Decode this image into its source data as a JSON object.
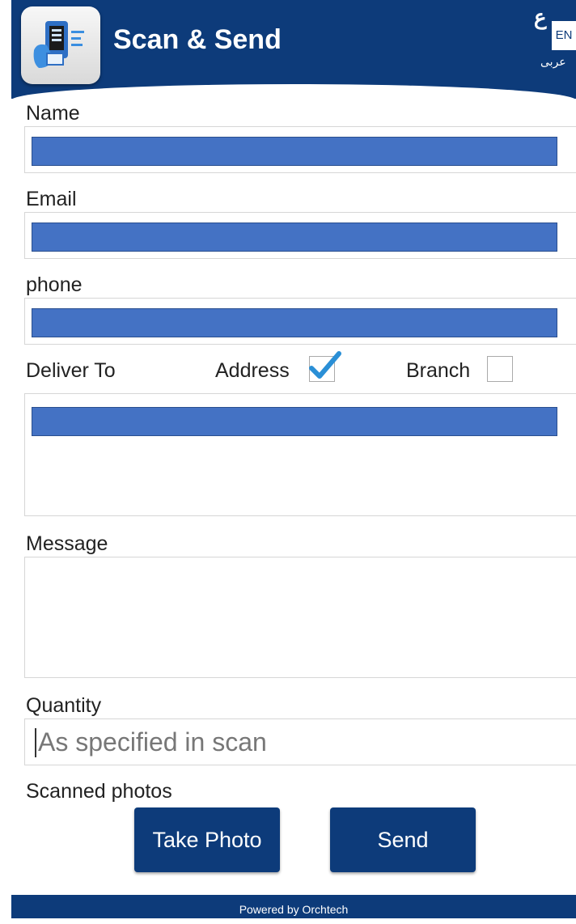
{
  "header": {
    "title": "Scan & Send",
    "app_icon": "scan-phone-icon",
    "lang_glyph": "ع",
    "lang_en": "EN",
    "lang_label": "عربى"
  },
  "form": {
    "name_label": "Name",
    "email_label": "Email",
    "phone_label": "phone",
    "deliver_label": "Deliver To",
    "address_label": "Address",
    "address_checked": true,
    "branch_label": "Branch",
    "branch_checked": false,
    "message_label": "Message",
    "quantity_label": "Quantity",
    "quantity_placeholder": "As specified in scan",
    "scanned_label": "Scanned photos"
  },
  "buttons": {
    "take_photo": "Take Photo",
    "send": "Send"
  },
  "footer": {
    "text": "Powered by Orchtech"
  },
  "colors": {
    "brand": "#0d3b7a",
    "redaction": "#4472c4",
    "check": "#2a8fd6"
  }
}
